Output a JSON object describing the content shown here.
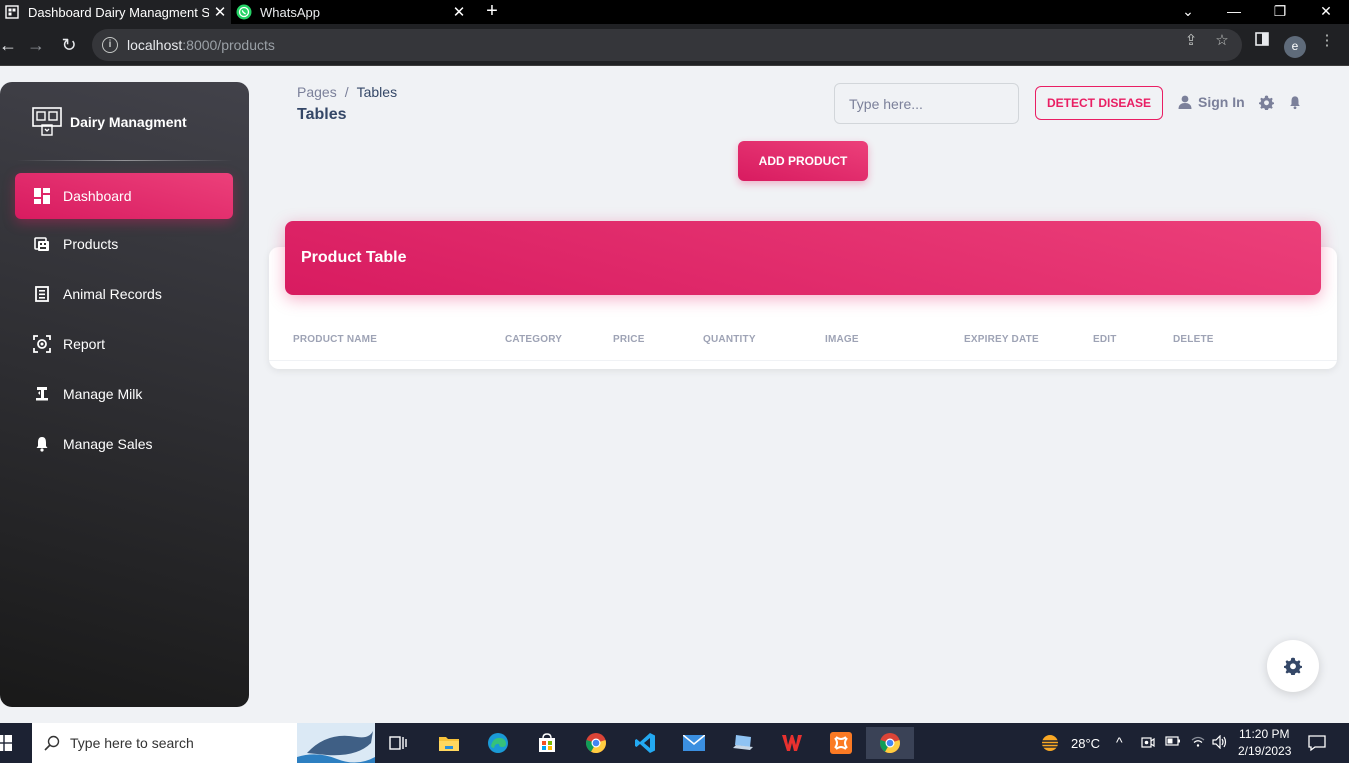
{
  "browser": {
    "tabs": [
      {
        "title": "Dashboard Dairy Managment Sys",
        "active": true
      },
      {
        "title": "WhatsApp",
        "active": false
      }
    ],
    "new_tab": "+",
    "url_host": "localhost",
    "url_path": ":8000/products",
    "profile_initial": "e"
  },
  "sidebar": {
    "brand": "Dairy Managment",
    "items": [
      {
        "label": "Dashboard",
        "icon": "dashboard-icon",
        "active": true
      },
      {
        "label": "Products",
        "icon": "products-icon"
      },
      {
        "label": "Animal Records",
        "icon": "records-icon"
      },
      {
        "label": "Report",
        "icon": "report-icon"
      },
      {
        "label": "Manage Milk",
        "icon": "milk-icon"
      },
      {
        "label": "Manage Sales",
        "icon": "bell-icon"
      }
    ]
  },
  "header": {
    "breadcrumb_root": "Pages",
    "breadcrumb_sep": "/",
    "breadcrumb_current": "Tables",
    "title": "Tables",
    "search_placeholder": "Type here...",
    "detect_disease": "DETECT DISEASE",
    "sign_in": "Sign In"
  },
  "main": {
    "add_product": "ADD PRODUCT",
    "table_title": "Product Table",
    "columns": [
      "PRODUCT NAME",
      "CATEGORY",
      "PRICE",
      "QUANTITY",
      "IMAGE",
      "EXPIREY DATE",
      "EDIT",
      "DELETE"
    ],
    "rows": []
  },
  "taskbar": {
    "search_placeholder": "Type here to search",
    "temperature": "28°C",
    "time": "11:20 PM",
    "date": "2/19/2023"
  },
  "colors": {
    "accent": "#e91e63",
    "sidebar_dark": "#191919",
    "text_dark": "#344767",
    "text_muted": "#7b809a"
  }
}
